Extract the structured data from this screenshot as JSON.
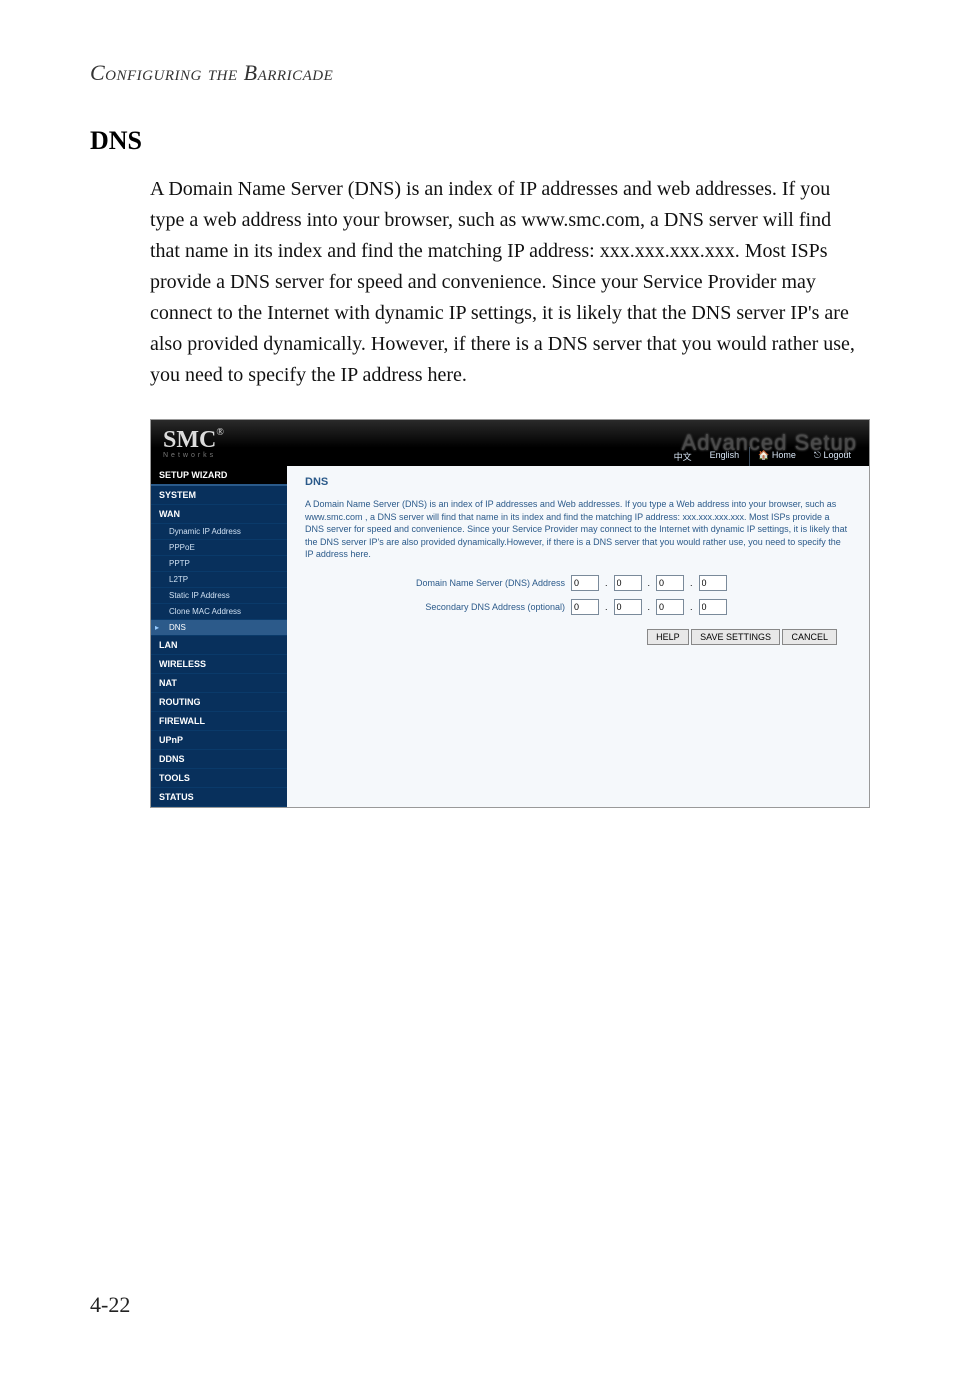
{
  "page": {
    "header": "Configuring the Barricade",
    "section_title": "DNS",
    "body": "A Domain Name Server (DNS) is an index of IP addresses and web addresses. If you type a web address into your browser, such as www.smc.com, a DNS server will find that name in its index and find the matching IP address: xxx.xxx.xxx.xxx. Most ISPs provide a DNS server for speed and convenience. Since your Service Provider may connect to the Internet with dynamic IP settings, it is likely that the DNS server IP's are also provided dynamically. However, if there is a DNS server that you would rather use, you need to specify the IP address here.",
    "page_number": "4-22"
  },
  "screenshot": {
    "logo": {
      "text": "SMC",
      "reg": "®",
      "subtitle": "Networks"
    },
    "banner_right": "Advanced Setup",
    "topnav": {
      "chinese": "中文",
      "english": "English",
      "home": "Home",
      "logout": "Logout"
    },
    "sidebar": {
      "setup_wizard": "SETUP WIZARD",
      "system": "SYSTEM",
      "wan": "WAN",
      "wan_sub": {
        "dynamic_ip": "Dynamic IP Address",
        "pppoe": "PPPoE",
        "pptp": "PPTP",
        "l2tp": "L2TP",
        "static_ip": "Static IP Address",
        "clone_mac": "Clone MAC Address",
        "dns": "DNS"
      },
      "lan": "LAN",
      "wireless": "WIRELESS",
      "nat": "NAT",
      "routing": "ROUTING",
      "firewall": "FIREWALL",
      "upnp": "UPnP",
      "ddns": "DDNS",
      "tools": "TOOLS",
      "status": "STATUS"
    },
    "content": {
      "title": "DNS",
      "description": "A Domain Name Server (DNS) is an index of IP addresses and Web addresses. If you type a Web address into your browser, such as www.smc.com , a DNS server will find that name in its index and find the matching IP address: xxx.xxx.xxx.xxx. Most ISPs provide a DNS server for speed and convenience. Since your Service Provider may connect to the Internet with dynamic IP settings, it is likely that the DNS server IP's are also provided dynamically.However, if there is a DNS server that you would rather use, you need to specify the IP address here.",
      "dns_label": "Domain Name Server (DNS) Address",
      "secondary_label": "Secondary DNS Address (optional)",
      "ip_values": {
        "a": "0",
        "b": "0",
        "c": "0",
        "d": "0"
      },
      "ip2_values": {
        "a": "0",
        "b": "0",
        "c": "0",
        "d": "0"
      },
      "buttons": {
        "help": "HELP",
        "save": "SAVE SETTINGS",
        "cancel": "CANCEL"
      }
    }
  }
}
